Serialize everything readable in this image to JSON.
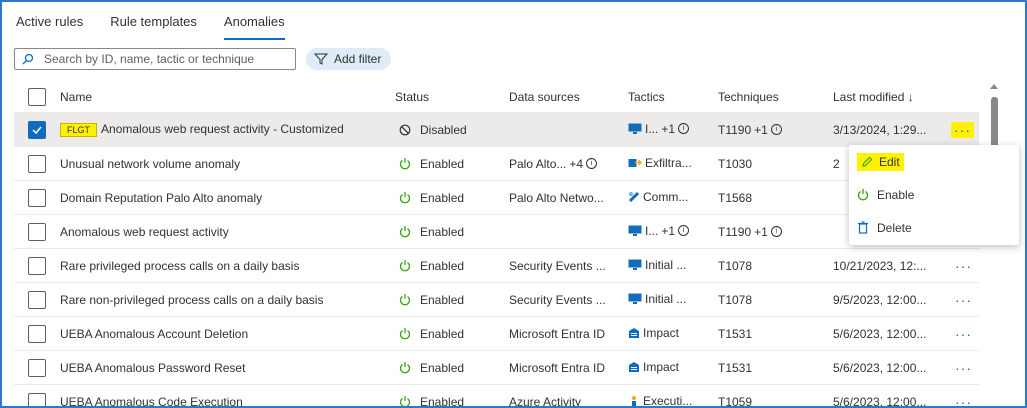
{
  "tabs": [
    {
      "label": "Active rules"
    },
    {
      "label": "Rule templates"
    },
    {
      "label": "Anomalies",
      "active": true
    }
  ],
  "search": {
    "placeholder": "Search by ID, name, tactic or technique"
  },
  "filter": {
    "label": "Add filter"
  },
  "columns": {
    "name": "Name",
    "status": "Status",
    "data_sources": "Data sources",
    "tactics": "Tactics",
    "techniques": "Techniques",
    "last_modified": "Last modified ↓"
  },
  "rows": [
    {
      "tag": "FLGT",
      "name": "Anomalous web request activity - Customized",
      "status": "Disabled",
      "data_source": "",
      "tactic": "I...",
      "tactic_extra": "+1",
      "technique": "T1190",
      "technique_extra": "+1",
      "modified": "3/13/2024, 1:29...",
      "selected": true
    },
    {
      "name": "Unusual network volume anomaly",
      "status": "Enabled",
      "data_source": "Palo Alto...",
      "data_source_extra": "+4",
      "tactic": "Exfiltra...",
      "technique": "T1030",
      "modified": "2"
    },
    {
      "name": "Domain Reputation Palo Alto anomaly",
      "status": "Enabled",
      "data_source": "Palo Alto Netwo...",
      "tactic": "Comm...",
      "technique": "T1568",
      "modified": ""
    },
    {
      "name": "Anomalous web request activity",
      "status": "Enabled",
      "data_source": "",
      "tactic": "I...",
      "tactic_extra": "+1",
      "technique": "T1190",
      "technique_extra": "+1",
      "modified": ""
    },
    {
      "name": "Rare privileged process calls on a daily basis",
      "status": "Enabled",
      "data_source": "Security Events ...",
      "tactic": "Initial ...",
      "technique": "T1078",
      "modified": "10/21/2023, 12:..."
    },
    {
      "name": "Rare non-privileged process calls on a daily basis",
      "status": "Enabled",
      "data_source": "Security Events ...",
      "tactic": "Initial ...",
      "technique": "T1078",
      "modified": "9/5/2023, 12:00..."
    },
    {
      "name": "UEBA Anomalous Account Deletion",
      "status": "Enabled",
      "data_source": "Microsoft Entra ID",
      "tactic": "Impact",
      "technique": "T1531",
      "modified": "5/6/2023, 12:00..."
    },
    {
      "name": "UEBA Anomalous Password Reset",
      "status": "Enabled",
      "data_source": "Microsoft Entra ID",
      "tactic": "Impact",
      "technique": "T1531",
      "modified": "5/6/2023, 12:00..."
    },
    {
      "name": "UEBA Anomalous Code Execution",
      "status": "Enabled",
      "data_source": "Azure Activity",
      "tactic": "Executi...",
      "technique": "T1059",
      "modified": "5/6/2023, 12:00..."
    }
  ],
  "more_label": "···",
  "context_menu": {
    "edit": "Edit",
    "enable": "Enable",
    "delete": "Delete"
  },
  "colors": {
    "accent": "#0f6cbd",
    "enabled": "#3aa50f",
    "highlight": "#fff100",
    "frame": "#2b78d4"
  }
}
